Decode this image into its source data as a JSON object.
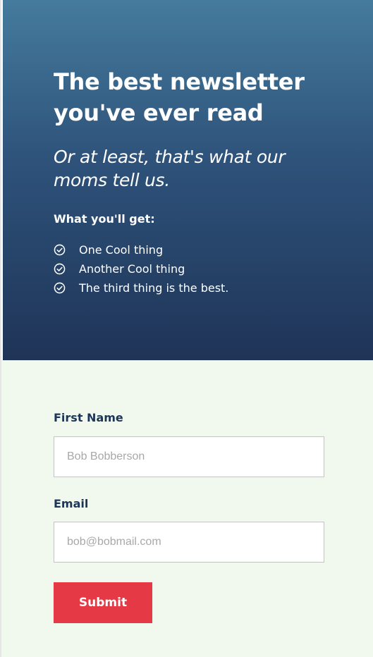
{
  "hero": {
    "title_line1": "The best newsletter",
    "title_line2": "you've ever read",
    "subtitle_line1": "Or at least, that's what our",
    "subtitle_line2": "moms tell us.",
    "benefits_heading": "What you'll get:",
    "benefits": [
      "One Cool thing",
      "Another Cool thing",
      "The third thing is the best."
    ],
    "icon": "check-circle-icon"
  },
  "form": {
    "first_name_label": "First Name",
    "first_name_placeholder": "Bob Bobberson",
    "first_name_value": "",
    "email_label": "Email",
    "email_placeholder": "bob@bobmail.com",
    "email_value": "",
    "submit_label": "Submit"
  },
  "colors": {
    "hero_top": "#457b9d",
    "hero_bottom": "#1f3457",
    "form_background": "#f1f8ee",
    "label_color": "#1d3557",
    "submit_background": "#e63946"
  }
}
